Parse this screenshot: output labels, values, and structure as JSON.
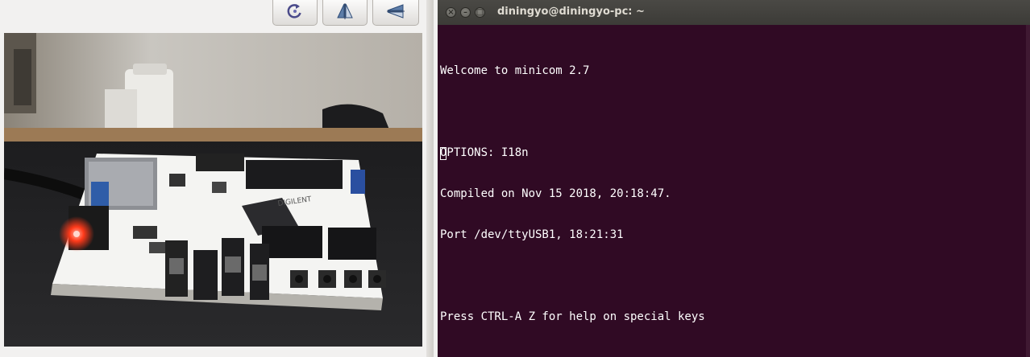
{
  "left_window": {
    "toolbar": [
      {
        "icon": "rotate-icon"
      },
      {
        "icon": "flip-vertical-icon"
      },
      {
        "icon": "flip-horizontal-icon"
      }
    ],
    "camera": {
      "board_brand": "DIGILENT"
    }
  },
  "terminal": {
    "title": "diningyo@diningyo-pc: ~",
    "lines": [
      "Welcome to minicom 2.7",
      "",
      "OPTIONS: I18n",
      "Compiled on Nov 15 2018, 20:18:47.",
      "Port /dev/ttyUSB1, 18:21:31",
      "",
      "Press CTRL-A Z for help on special keys"
    ],
    "colors": {
      "background": "#300a24",
      "text": "#ffffff",
      "titlebar": "#3c3b37"
    }
  }
}
